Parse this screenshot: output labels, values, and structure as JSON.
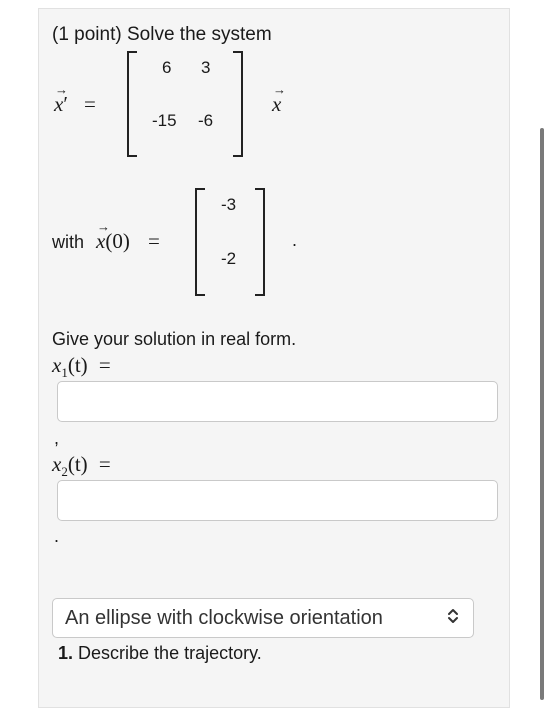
{
  "problem": {
    "title": "(1 point) Solve the system",
    "lhs": "x",
    "prime": "′",
    "equals": "=",
    "rhs_var": "x",
    "matrix": {
      "r1c1": "6",
      "r1c2": "3",
      "r2c1": "-15",
      "r2c2": "-6"
    },
    "initial": {
      "with_label": "with",
      "var": "x",
      "arg": "(0)",
      "equals": "=",
      "values": [
        "-3",
        "-2"
      ],
      "period": "."
    },
    "instruction": "Give your solution in real form.",
    "x1_label": "x",
    "x1_sub": "1",
    "x1_arg": "(t)",
    "x1_eq": "=",
    "separator_comma": ",",
    "x2_label": "x",
    "x2_sub": "2",
    "x2_arg": "(t)",
    "x2_eq": "=",
    "separator_period": "."
  },
  "trajectory": {
    "selected": "An ellipse with clockwise orientation",
    "question_number": "1.",
    "question_text": "Describe the trajectory."
  },
  "icons": {
    "arrow": "→",
    "select_chevrons": "⌃⌄"
  }
}
